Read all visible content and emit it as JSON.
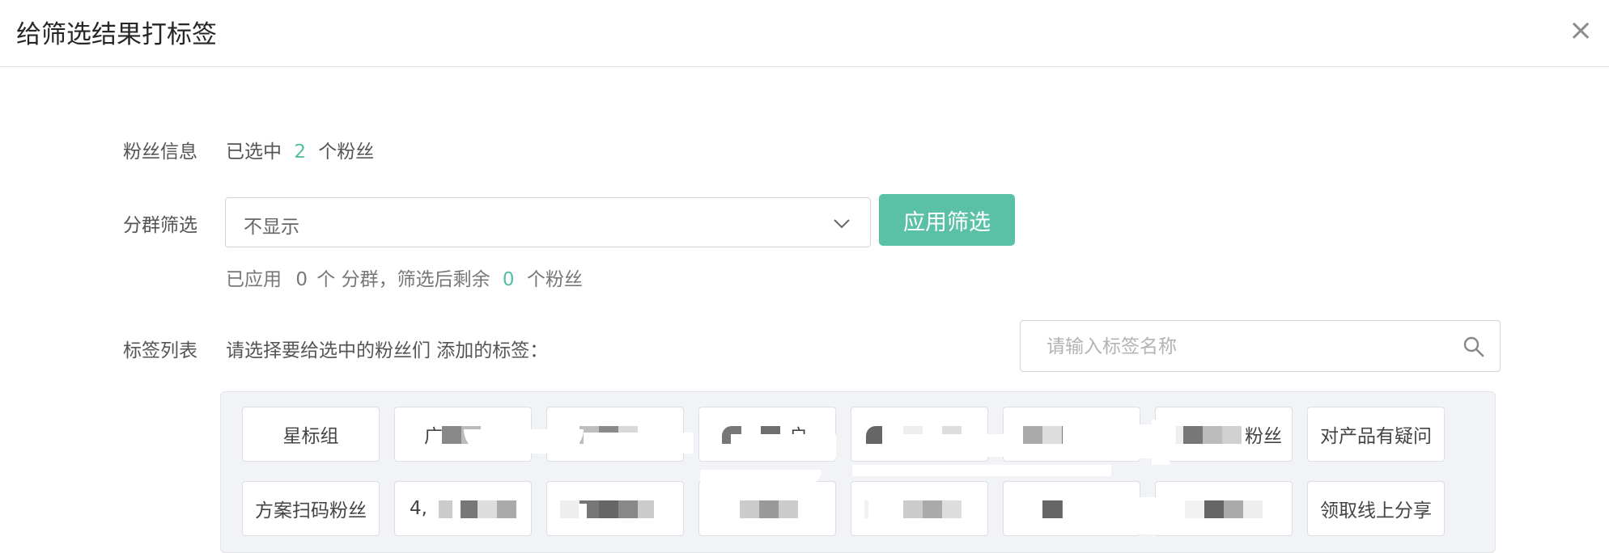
{
  "dialog": {
    "title": "给筛选结果打标签",
    "close_glyph": "×"
  },
  "fans": {
    "label": "粉丝信息",
    "prefix": "已选中",
    "count": "2",
    "suffix": "个粉丝"
  },
  "group_filter": {
    "label": "分群筛选",
    "selected": "不显示",
    "apply_label": "应用筛选",
    "summary": {
      "prefix": "已应用",
      "groups": "0",
      "middle": "个 分群，筛选后剩余",
      "remaining": "0",
      "suffix": "个粉丝"
    }
  },
  "tag_list": {
    "label": "标签列表",
    "hint": "请选择要给选中的粉丝们 添加的标签：",
    "search_placeholder": "请输入标签名称",
    "row1": [
      "星标组",
      "广",
      "",
      "户",
      "",
      "",
      "粉丝",
      "对产品有疑问"
    ],
    "row2": [
      "方案扫码粉丝",
      "4,",
      "",
      "",
      "",
      "",
      "",
      "领取线上分享"
    ]
  },
  "colors": {
    "accent": "#5bc1a6",
    "border": "#dcdfe6",
    "panel_bg": "#f2f3f6"
  },
  "icons": {
    "close": "close-icon",
    "dropdown": "chevron-down-icon",
    "search": "search-icon"
  }
}
